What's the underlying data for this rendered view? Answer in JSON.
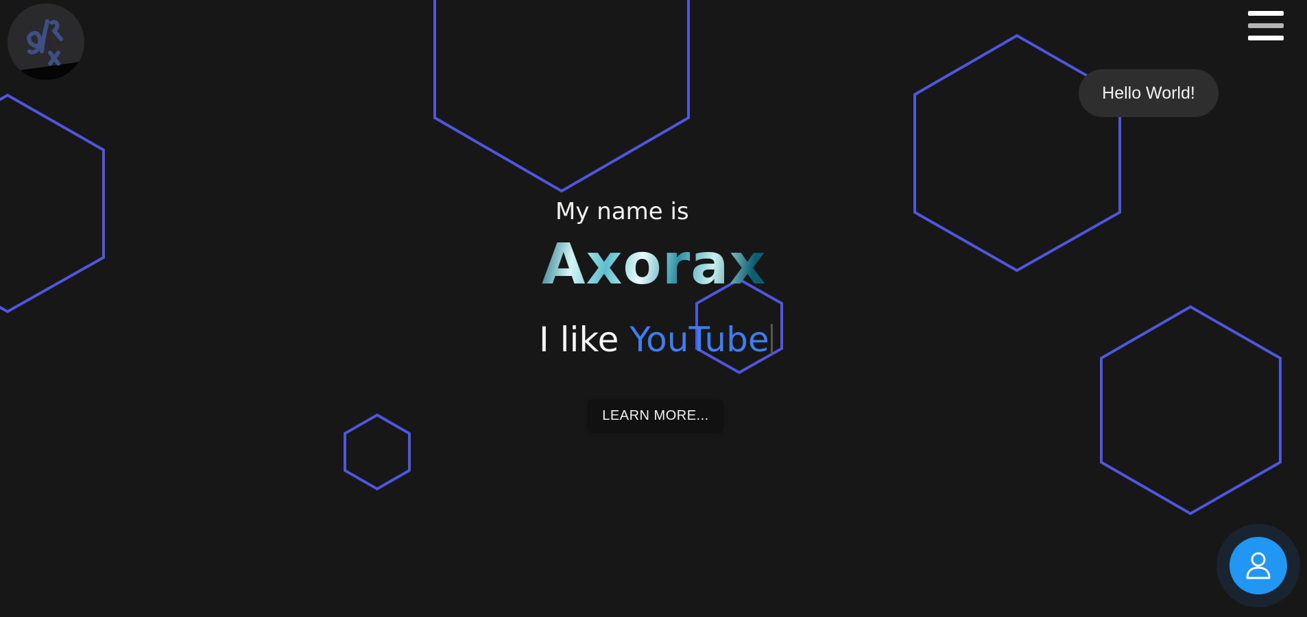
{
  "logo": {
    "alt": "Axorax logo",
    "glyph_text": "aRx"
  },
  "menu": {
    "icon": "hamburger-menu-icon"
  },
  "toast": {
    "text": "Hello World!"
  },
  "hero": {
    "intro": "My name is",
    "name": "Axorax",
    "tagline_prefix": "I like ",
    "tagline_highlight": "YouTube",
    "learn_more_label": "LEARN MORE..."
  },
  "profile_button": {
    "icon": "user-icon"
  },
  "colors": {
    "background": "#171718",
    "hexagon_stroke": "#4f56e0",
    "accent_blue": "#3d7ef2",
    "fab_blue": "#2196f3",
    "toast_bg": "#2e2e2f"
  }
}
